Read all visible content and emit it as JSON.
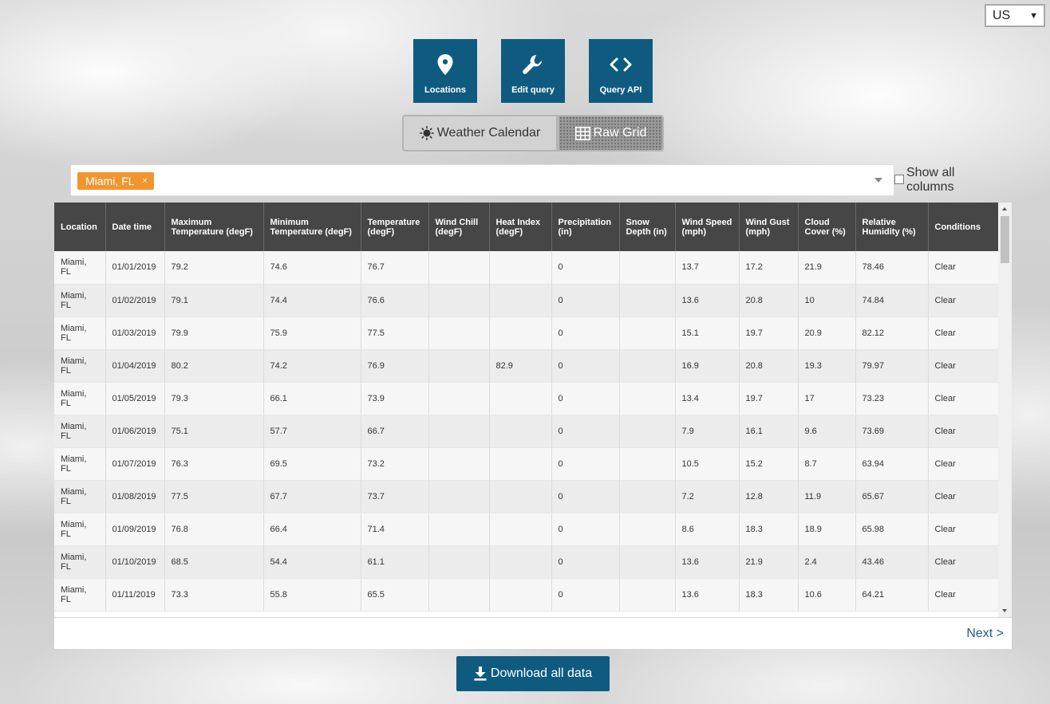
{
  "units": {
    "selected": "US"
  },
  "toolbar": {
    "locations_label": "Locations",
    "edit_query_label": "Edit query",
    "query_api_label": "Query API"
  },
  "view_toggle": {
    "calendar_label": "Weather Calendar",
    "grid_label": "Raw Grid"
  },
  "location_filter": {
    "tag": "Miami, FL",
    "tag_remove": "×"
  },
  "show_all_columns_label": "Show all columns",
  "grid": {
    "columns": [
      "Location",
      "Date time",
      "Maximum Temperature (degF)",
      "Minimum Temperature (degF)",
      "Temperature (degF)",
      "Wind Chill (degF)",
      "Heat Index (degF)",
      "Precipitation (in)",
      "Snow Depth (in)",
      "Wind Speed (mph)",
      "Wind Gust (mph)",
      "Cloud Cover (%)",
      "Relative Humidity (%)",
      "Conditions"
    ],
    "rows": [
      [
        "Miami, FL",
        "01/01/2019",
        "79.2",
        "74.6",
        "76.7",
        "",
        "",
        "0",
        "",
        "13.7",
        "17.2",
        "21.9",
        "78.46",
        "Clear"
      ],
      [
        "Miami, FL",
        "01/02/2019",
        "79.1",
        "74.4",
        "76.6",
        "",
        "",
        "0",
        "",
        "13.6",
        "20.8",
        "10",
        "74.84",
        "Clear"
      ],
      [
        "Miami, FL",
        "01/03/2019",
        "79.9",
        "75.9",
        "77.5",
        "",
        "",
        "0",
        "",
        "15.1",
        "19.7",
        "20.9",
        "82.12",
        "Clear"
      ],
      [
        "Miami, FL",
        "01/04/2019",
        "80.2",
        "74.2",
        "76.9",
        "",
        "82.9",
        "0",
        "",
        "16.9",
        "20.8",
        "19.3",
        "79.97",
        "Clear"
      ],
      [
        "Miami, FL",
        "01/05/2019",
        "79.3",
        "66.1",
        "73.9",
        "",
        "",
        "0",
        "",
        "13.4",
        "19.7",
        "17",
        "73.23",
        "Clear"
      ],
      [
        "Miami, FL",
        "01/06/2019",
        "75.1",
        "57.7",
        "66.7",
        "",
        "",
        "0",
        "",
        "7.9",
        "16.1",
        "9.6",
        "73.69",
        "Clear"
      ],
      [
        "Miami, FL",
        "01/07/2019",
        "76.3",
        "69.5",
        "73.2",
        "",
        "",
        "0",
        "",
        "10.5",
        "15.2",
        "8.7",
        "63.94",
        "Clear"
      ],
      [
        "Miami, FL",
        "01/08/2019",
        "77.5",
        "67.7",
        "73.7",
        "",
        "",
        "0",
        "",
        "7.2",
        "12.8",
        "11.9",
        "65.67",
        "Clear"
      ],
      [
        "Miami, FL",
        "01/09/2019",
        "76.8",
        "66.4",
        "71.4",
        "",
        "",
        "0",
        "",
        "8.6",
        "18.3",
        "18.9",
        "65.98",
        "Clear"
      ],
      [
        "Miami, FL",
        "01/10/2019",
        "68.5",
        "54.4",
        "61.1",
        "",
        "",
        "0",
        "",
        "13.6",
        "21.9",
        "2.4",
        "43.46",
        "Clear"
      ],
      [
        "Miami, FL",
        "01/11/2019",
        "73.3",
        "55.8",
        "65.5",
        "",
        "",
        "0",
        "",
        "13.6",
        "18.3",
        "10.6",
        "64.21",
        "Clear"
      ]
    ]
  },
  "pagination": {
    "next_label": "Next >"
  },
  "download_label": "Download all data",
  "colors": {
    "primary": "#0f5b80",
    "tag": "#f0962f",
    "header_bg": "#464646",
    "link": "#1e5a86"
  }
}
